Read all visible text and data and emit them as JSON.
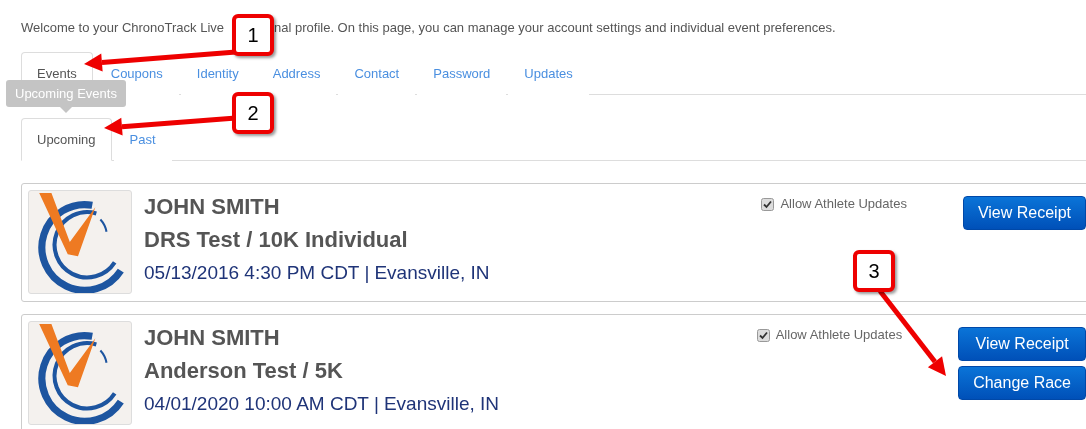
{
  "intro": {
    "before": "Welcome to your ChronoTrack Live",
    "after": "nal profile. On this page, you can manage your account settings and individual event preferences."
  },
  "tabs": [
    {
      "label": "Events",
      "selected": true
    },
    {
      "label": "Coupons",
      "selected": false
    },
    {
      "label": "Identity",
      "selected": false
    },
    {
      "label": "Address",
      "selected": false
    },
    {
      "label": "Contact",
      "selected": false
    },
    {
      "label": "Password",
      "selected": false
    },
    {
      "label": "Updates",
      "selected": false
    }
  ],
  "tooltip": "Upcoming Events",
  "subtabs": [
    {
      "label": "Upcoming",
      "selected": true
    },
    {
      "label": "Past",
      "selected": false
    }
  ],
  "registrations": [
    {
      "name": "JOHN SMITH",
      "event": "DRS Test / 10K Individual",
      "date": "05/13/2016 4:30 PM CDT",
      "separator": "|",
      "location": "Evansville, IN",
      "allow_updates_label": "Allow Athlete Updates",
      "allow_updates": true,
      "buttons": [
        "View Receipt"
      ]
    },
    {
      "name": "JOHN SMITH",
      "event": "Anderson Test / 5K",
      "date": "04/01/2020 10:00 AM CDT",
      "separator": "|",
      "location": "Evansville, IN",
      "allow_updates_label": "Allow Athlete Updates",
      "allow_updates": true,
      "buttons": [
        "View Receipt",
        "Change Race"
      ]
    }
  ],
  "callouts": [
    {
      "number": "1"
    },
    {
      "number": "2"
    },
    {
      "number": "3"
    }
  ]
}
